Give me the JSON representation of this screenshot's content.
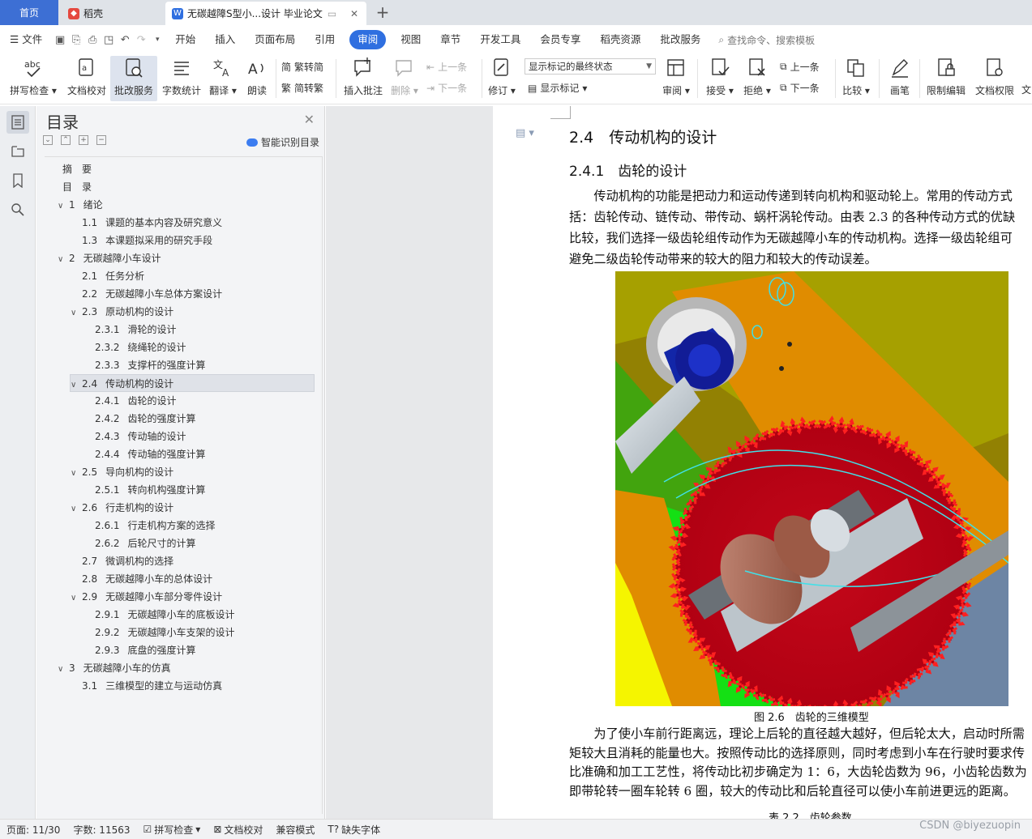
{
  "tabs": {
    "home": "首页",
    "wk": "稻壳",
    "doc": "无碳越障S型小...设计 毕业论文"
  },
  "menubar": {
    "file": "文件",
    "items": [
      "开始",
      "插入",
      "页面布局",
      "引用",
      "审阅",
      "视图",
      "章节",
      "开发工具",
      "会员专享",
      "稻壳资源",
      "批改服务"
    ],
    "active": "审阅",
    "search": "查找命令、搜索模板"
  },
  "ribbon": {
    "spell": "拼写检查",
    "proof": "文档校对",
    "correct": "批改服务",
    "wordcount": "字数统计",
    "translate": "翻译",
    "read": "朗读",
    "trad": "繁转简",
    "simp": "简转繁",
    "insert_comment": "插入批注",
    "delete": "删除",
    "prev": "上一条",
    "next": "下一条",
    "revise": "修订",
    "markup_state": "显示标记的最终状态",
    "show_markup": "显示标记",
    "review": "审阅",
    "accept": "接受",
    "reject": "拒绝",
    "prev2": "上一条",
    "next2": "下一条",
    "compare": "比较",
    "pen": "画笔",
    "restrict": "限制编辑",
    "perm": "文档权限",
    "more": "文"
  },
  "toc": {
    "title": "目录",
    "smart": "智能识别目录",
    "items": [
      {
        "num": "",
        "text": "摘　要",
        "level": 0
      },
      {
        "num": "",
        "text": "目　录",
        "level": 0
      },
      {
        "num": "1",
        "text": "绪论",
        "level": 1
      },
      {
        "num": "1.1",
        "text": "课题的基本内容及研究意义",
        "level": 2
      },
      {
        "num": "1.3",
        "text": "本课题拟采用的研究手段",
        "level": 2
      },
      {
        "num": "2",
        "text": "无碳越障小车设计",
        "level": 1
      },
      {
        "num": "2.1",
        "text": "任务分析",
        "level": 2
      },
      {
        "num": "2.2",
        "text": "无碳越障小车总体方案设计",
        "level": 2
      },
      {
        "num": "2.3",
        "text": "原动机构的设计",
        "level": 2
      },
      {
        "num": "2.3.1",
        "text": "滑轮的设计",
        "level": 3
      },
      {
        "num": "2.3.2",
        "text": "绕绳轮的设计",
        "level": 3
      },
      {
        "num": "2.3.3",
        "text": "支撑杆的强度计算",
        "level": 3
      },
      {
        "num": "2.4",
        "text": "传动机构的设计",
        "level": 2
      },
      {
        "num": "2.4.1",
        "text": "齿轮的设计",
        "level": 3
      },
      {
        "num": "2.4.2",
        "text": "齿轮的强度计算",
        "level": 3
      },
      {
        "num": "2.4.3",
        "text": "传动轴的设计",
        "level": 3
      },
      {
        "num": "2.4.4",
        "text": "传动轴的强度计算",
        "level": 3
      },
      {
        "num": "2.5",
        "text": "导向机构的设计",
        "level": 2
      },
      {
        "num": "2.5.1",
        "text": "转向机构强度计算",
        "level": 3
      },
      {
        "num": "2.6",
        "text": "行走机构的设计",
        "level": 2
      },
      {
        "num": "2.6.1",
        "text": "行走机构方案的选择",
        "level": 3
      },
      {
        "num": "2.6.2",
        "text": "后轮尺寸的计算",
        "level": 3
      },
      {
        "num": "2.7",
        "text": "微调机构的选择",
        "level": 2
      },
      {
        "num": "2.8",
        "text": "无碳越障小车的总体设计",
        "level": 2
      },
      {
        "num": "2.9",
        "text": "无碳越障小车部分零件设计",
        "level": 2
      },
      {
        "num": "2.9.1",
        "text": "无碳越障小车的底板设计",
        "level": 3
      },
      {
        "num": "2.9.2",
        "text": "无碳越障小车支架的设计",
        "level": 3
      },
      {
        "num": "2.9.3",
        "text": "底盘的强度计算",
        "level": 3
      },
      {
        "num": "3",
        "text": "无碳越障小车的仿真",
        "level": 1
      },
      {
        "num": "3.1",
        "text": "三维模型的建立与运动仿真",
        "level": 2
      }
    ]
  },
  "document": {
    "h2_num": "2.4",
    "h2_text": "传动机构的设计",
    "h3_num": "2.4.1",
    "h3_text": "齿轮的设计",
    "p1": [
      "　　传动机构的功能是把动力和运动传递到转向机构和驱动轮上。常用的传动方式",
      "括：齿轮传动、链传动、带传动、蜗杆涡轮传动。由表 2.3 的各种传动方式的优缺",
      "比较，我们选择一级齿轮组传动作为无碳越障小车的传动机构。选择一级齿轮组可",
      "避免二级齿轮传动带来的较大的阻力和较大的传动误差。"
    ],
    "caption": "图 2.6　齿轮的三维模型",
    "p2": [
      "　　为了使小车前行距离远，理论上后轮的直径越大越好，但后轮太大，启动时所需",
      "矩较大且消耗的能量也大。按照传动比的选择原则，同时考虑到小车在行驶时要求传",
      "比准确和加工工艺性，将传动比初步确定为 1：6，大齿轮齿数为 96，小齿轮齿数为",
      "即带轮转一圈车轮转 6 圈，较大的传动比和后轮直径可以使小车前进更远的距离。"
    ],
    "table_title": "表 2.2　齿轮参数"
  },
  "status": {
    "page": "页面: 11/30",
    "words": "字数: 11563",
    "spell": "拼写检查",
    "proof": "文档校对",
    "compat": "兼容模式",
    "missing_font": "缺失字体"
  },
  "watermark": "CSDN @biyezuopin",
  "colors": {
    "accent": "#2f6fe0",
    "home_tab": "#3d6fd4"
  }
}
